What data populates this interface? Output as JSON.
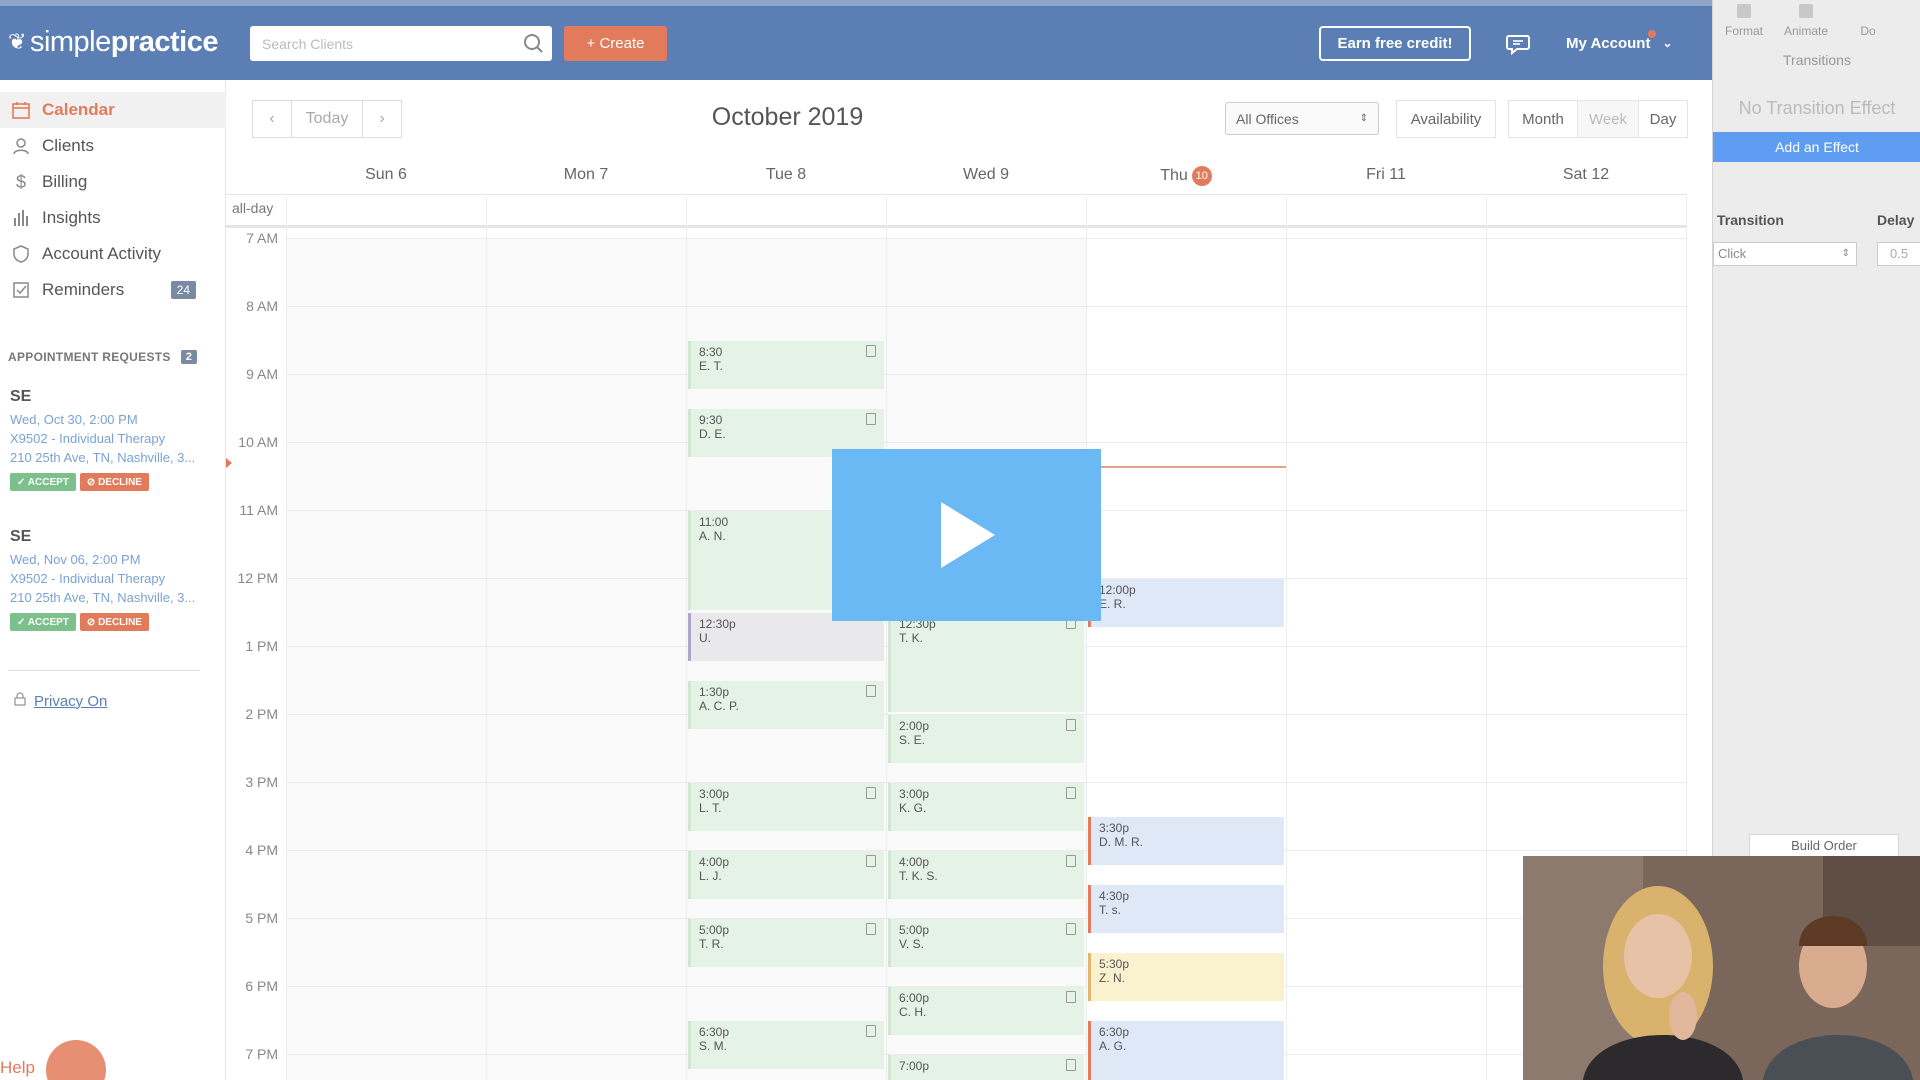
{
  "app": {
    "logo_light": "simple",
    "logo_bold": "practice",
    "search_placeholder": "Search Clients",
    "create_label": "+ Create",
    "earn_label": "Earn free credit!",
    "account_label": "My Account"
  },
  "sidebar": {
    "items": [
      {
        "label": "Calendar",
        "icon": "calendar-icon"
      },
      {
        "label": "Clients",
        "icon": "person-icon"
      },
      {
        "label": "Billing",
        "icon": "dollar-icon"
      },
      {
        "label": "Insights",
        "icon": "bar-chart-icon"
      },
      {
        "label": "Account Activity",
        "icon": "shield-icon"
      },
      {
        "label": "Reminders",
        "icon": "checklist-icon",
        "badge": "24"
      }
    ],
    "requests_title": "APPOINTMENT REQUESTS",
    "requests_count": "2",
    "requests": [
      {
        "initials": "SE",
        "date": "Wed, Oct 30, 2:00 PM",
        "service": "X9502 - Individual Therapy",
        "address": "210 25th Ave, TN, Nashville, 3...",
        "accept": "✓ ACCEPT",
        "decline": "⊘ DECLINE"
      },
      {
        "initials": "SE",
        "date": "Wed, Nov 06, 2:00 PM",
        "service": "X9502 - Individual Therapy",
        "address": "210 25th Ave, TN, Nashville, 3...",
        "accept": "✓ ACCEPT",
        "decline": "⊘ DECLINE"
      }
    ],
    "privacy_label": "Privacy On",
    "help_label": "Help"
  },
  "calendar": {
    "today_label": "Today",
    "title": "October 2019",
    "office_select": "All Offices",
    "availability_label": "Availability",
    "views": [
      "Month",
      "Week",
      "Day"
    ],
    "allday_label": "all-day",
    "days": [
      "Sun 6",
      "Mon 7",
      "Tue 8",
      "Wed 9",
      "Thu",
      "Fri 11",
      "Sat 12"
    ],
    "today_number": "10",
    "hours": [
      "7 AM",
      "8 AM",
      "9 AM",
      "10 AM",
      "11 AM",
      "12 PM",
      "1 PM",
      "2 PM",
      "3 PM",
      "4 PM",
      "5 PM",
      "6 PM",
      "7 PM"
    ],
    "appointments": [
      {
        "day": 2,
        "start": 8.5,
        "end": 9.25,
        "time": "8:30",
        "name": "E. T.",
        "color": "green",
        "note": true
      },
      {
        "day": 2,
        "start": 9.5,
        "end": 10.25,
        "time": "9:30",
        "name": "D. E.",
        "color": "green",
        "note": true
      },
      {
        "day": 2,
        "start": 11.0,
        "end": 12.5,
        "time": "11:00",
        "name": "A. N.",
        "color": "green",
        "note": true
      },
      {
        "day": 2,
        "start": 12.5,
        "end": 13.25,
        "time": "12:30p",
        "name": "U.",
        "color": "grey",
        "note": false
      },
      {
        "day": 2,
        "start": 13.5,
        "end": 14.25,
        "time": "1:30p",
        "name": "A. C. P.",
        "color": "green",
        "note": true
      },
      {
        "day": 2,
        "start": 15.0,
        "end": 15.75,
        "time": "3:00p",
        "name": "L. T.",
        "color": "green",
        "note": true
      },
      {
        "day": 2,
        "start": 16.0,
        "end": 16.75,
        "time": "4:00p",
        "name": "L. J.",
        "color": "green",
        "note": true
      },
      {
        "day": 2,
        "start": 17.0,
        "end": 17.75,
        "time": "5:00p",
        "name": "T. R.",
        "color": "green",
        "note": true
      },
      {
        "day": 2,
        "start": 18.5,
        "end": 19.25,
        "time": "6:30p",
        "name": "S. M.",
        "color": "green",
        "note": true
      },
      {
        "day": 3,
        "start": 12.5,
        "end": 14.0,
        "time": "12:30p",
        "name": "T. K.",
        "color": "green",
        "note": true
      },
      {
        "day": 3,
        "start": 14.0,
        "end": 14.75,
        "time": "2:00p",
        "name": "S. E.",
        "color": "green",
        "note": true
      },
      {
        "day": 3,
        "start": 15.0,
        "end": 15.75,
        "time": "3:00p",
        "name": "K. G.",
        "color": "green",
        "note": true
      },
      {
        "day": 3,
        "start": 16.0,
        "end": 16.75,
        "time": "4:00p",
        "name": "T. K. S.",
        "color": "green",
        "note": true
      },
      {
        "day": 3,
        "start": 17.0,
        "end": 17.75,
        "time": "5:00p",
        "name": "V. S.",
        "color": "green",
        "note": true
      },
      {
        "day": 3,
        "start": 18.0,
        "end": 18.75,
        "time": "6:00p",
        "name": "C. H.",
        "color": "green",
        "note": true
      },
      {
        "day": 3,
        "start": 19.0,
        "end": 19.5,
        "time": "7:00p",
        "name": "",
        "color": "green",
        "note": true
      },
      {
        "day": 4,
        "start": 12.0,
        "end": 12.75,
        "time": "12:00p",
        "name": "E. R.",
        "color": "blue",
        "note": false
      },
      {
        "day": 4,
        "start": 15.5,
        "end": 16.25,
        "time": "3:30p",
        "name": "D. M. R.",
        "color": "blue",
        "note": false
      },
      {
        "day": 4,
        "start": 16.5,
        "end": 17.25,
        "time": "4:30p",
        "name": "T. s.",
        "color": "blue",
        "note": false
      },
      {
        "day": 4,
        "start": 17.5,
        "end": 18.25,
        "time": "5:30p",
        "name": "Z. N.",
        "color": "yellow",
        "note": false
      },
      {
        "day": 4,
        "start": 18.5,
        "end": 19.5,
        "time": "6:30p",
        "name": "A. G.",
        "color": "blue",
        "note": false
      }
    ]
  },
  "keynote_panel": {
    "tabs": [
      "Format",
      "Animate",
      "Do"
    ],
    "section": "Transitions",
    "no_effect": "No Transition Effect",
    "add_effect": "Add an Effect",
    "transition_label": "Transition",
    "delay_label": "Delay",
    "transition_value": "Click",
    "delay_value": "0.5",
    "build_order": "Build Order"
  },
  "colors": {
    "brand_blue": "#5b7fb5",
    "accent_orange": "#e27b5b",
    "appt_green": "#e5f2e6",
    "appt_blue": "#dfe8f6",
    "appt_yellow": "#faf1cf",
    "play_blue": "#6ab8f4"
  }
}
